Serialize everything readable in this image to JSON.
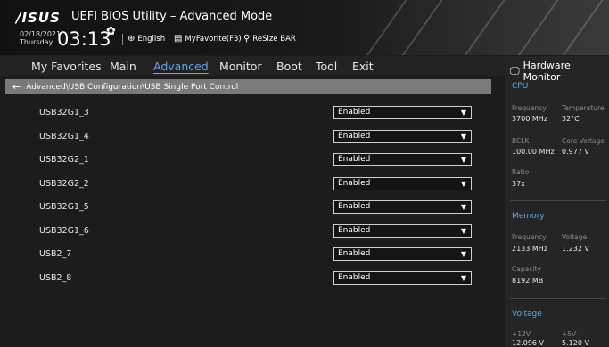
{
  "header": {
    "logo": "/ISUS",
    "title": "UEFI BIOS Utility – Advanced Mode",
    "date": "02/18/2021",
    "day": "Thursday",
    "time": "03:13",
    "language": "English",
    "myfavorite": "MyFavorite(F3)",
    "resize_bar": "ReSize BAR"
  },
  "menu": [
    "My Favorites",
    "Main",
    "Advanced",
    "Monitor",
    "Boot",
    "Tool",
    "Exit"
  ],
  "active_menu": "Advanced",
  "breadcrumb": "Advanced\\USB Configuration\\USB Single Port Control",
  "ports": [
    {
      "label": "USB32G1_3",
      "value": "Enabled"
    },
    {
      "label": "USB32G1_4",
      "value": "Enabled"
    },
    {
      "label": "USB32G2_1",
      "value": "Enabled"
    },
    {
      "label": "USB32G2_2",
      "value": "Enabled"
    },
    {
      "label": "USB32G1_5",
      "value": "Enabled"
    },
    {
      "label": "USB32G1_6",
      "value": "Enabled"
    },
    {
      "label": "USB2_7",
      "value": "Enabled"
    },
    {
      "label": "USB2_8",
      "value": "Enabled"
    }
  ],
  "hw": {
    "title": "Hardware Monitor",
    "cpu": {
      "heading": "CPU",
      "frequency_label": "Frequency",
      "frequency": "3700 MHz",
      "temperature_label": "Temperature",
      "temperature": "32°C",
      "bclk_label": "BCLK",
      "bclk": "100.00 MHz",
      "core_voltage_label": "Core Voltage",
      "core_voltage": "0.977 V",
      "ratio_label": "Ratio",
      "ratio": "37x"
    },
    "memory": {
      "heading": "Memory",
      "frequency_label": "Frequency",
      "frequency": "2133 MHz",
      "voltage_label": "Voltage",
      "voltage": "1.232 V",
      "capacity_label": "Capacity",
      "capacity": "8192 MB"
    },
    "voltage": {
      "heading": "Voltage",
      "v12_label": "+12V",
      "v12": "12.096 V",
      "v5_label": "+5V",
      "v5": "5.120 V"
    }
  },
  "colors": {
    "accent": "#5ea9f0",
    "breadcrumb_bg": "#7a7a7a"
  }
}
